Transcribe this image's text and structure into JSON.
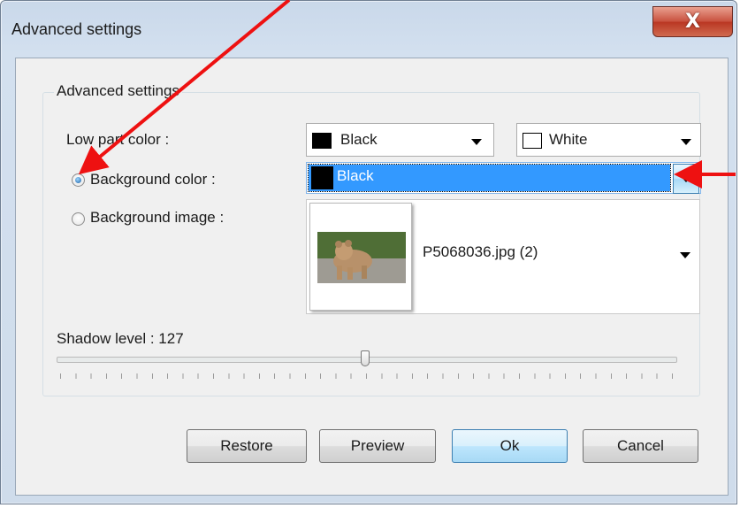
{
  "window": {
    "title": "Advanced settings",
    "close_label": "X"
  },
  "group": {
    "legend": "Advanced settings"
  },
  "low_part": {
    "label": "Low part color :",
    "color1": {
      "text": "Black",
      "swatch": "#000000"
    },
    "color2": {
      "text": "White",
      "swatch": "#ffffff"
    }
  },
  "background_color": {
    "label": "Background color :",
    "selected": true,
    "value": "Black",
    "swatch": "#000000"
  },
  "background_image": {
    "label": "Background image :",
    "selected": false,
    "value": "P5068036.jpg (2)"
  },
  "shadow": {
    "label": "Shadow level : 127",
    "value": 127,
    "max": 255
  },
  "buttons": {
    "restore": "Restore",
    "preview": "Preview",
    "ok": "Ok",
    "cancel": "Cancel"
  },
  "colors": {
    "selection": "#3399ff",
    "annotation_arrow": "#ee1111"
  }
}
